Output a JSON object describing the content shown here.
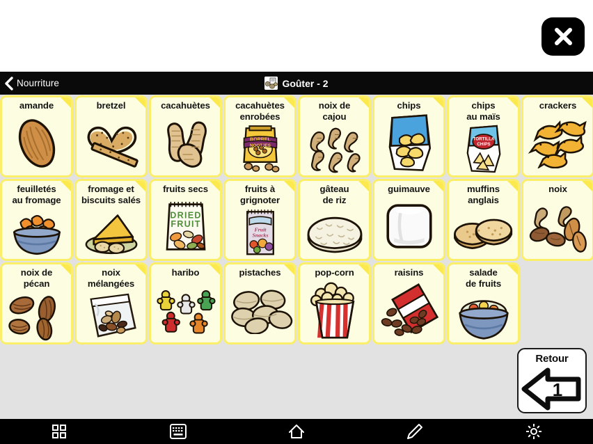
{
  "window": {
    "close_button_label": "close",
    "background_color": "#e2e2e2",
    "card_background_color": "#fdfde2",
    "card_border_color": "#fbef6a"
  },
  "header": {
    "back_label": "Nourriture",
    "title": "Goûter - 2",
    "icon": "snack-tray-icon"
  },
  "grid": {
    "rows": [
      [
        {
          "label": "amande",
          "art": "almond"
        },
        {
          "label": "bretzel",
          "art": "pretzel"
        },
        {
          "label": "cacahuètes",
          "art": "peanuts"
        },
        {
          "label": "cacahuètes\nenrobées",
          "art": "coated-peanuts-bag"
        },
        {
          "label": "noix de\ncajou",
          "art": "cashews"
        },
        {
          "label": "chips",
          "art": "chips-bag"
        },
        {
          "label": "chips\nau maïs",
          "art": "tortilla-chips-bag"
        },
        {
          "label": "crackers",
          "art": "fish-crackers"
        }
      ],
      [
        {
          "label": "feuilletés\nau fromage",
          "art": "cheese-puffs-bowl"
        },
        {
          "label": "fromage et\nbiscuits salés",
          "art": "cheese-and-crackers"
        },
        {
          "label": "fruits secs",
          "art": "dried-fruit-bag"
        },
        {
          "label": "fruits à\ngrignoter",
          "art": "fruit-snacks-pack"
        },
        {
          "label": "gâteau\nde riz",
          "art": "rice-cake"
        },
        {
          "label": "guimauve",
          "art": "marshmallow"
        },
        {
          "label": "muffins\nanglais",
          "art": "english-muffins"
        },
        {
          "label": "noix",
          "art": "mixed-nuts"
        }
      ],
      [
        {
          "label": "noix de\npécan",
          "art": "pecans"
        },
        {
          "label": "noix\nmélangées",
          "art": "mixed-nuts-bag"
        },
        {
          "label": "haribo",
          "art": "gummy-bears"
        },
        {
          "label": "pistaches",
          "art": "pistachios"
        },
        {
          "label": "pop-corn",
          "art": "popcorn-box"
        },
        {
          "label": "raisins",
          "art": "raisins-box"
        },
        {
          "label": "salade\nde fruits",
          "art": "fruit-salad-bowl"
        }
      ]
    ]
  },
  "retour": {
    "label": "Retour",
    "page_number": "1"
  },
  "bottom_nav": {
    "items": [
      {
        "name": "grid-icon",
        "label": "grid"
      },
      {
        "name": "keyboard-icon",
        "label": "keyboard"
      },
      {
        "name": "home-icon",
        "label": "home"
      },
      {
        "name": "pencil-icon",
        "label": "edit"
      },
      {
        "name": "gear-icon",
        "label": "settings"
      }
    ]
  }
}
